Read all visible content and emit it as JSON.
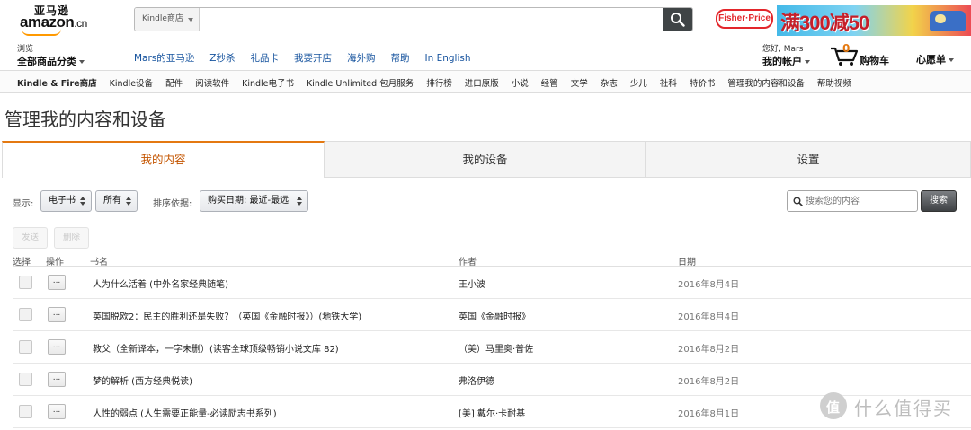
{
  "header": {
    "logo_cn": "亚马逊",
    "logo_en": "amazon",
    "logo_domain": ".cn",
    "search_category": "Kindle商店",
    "search_value": "",
    "ad_brand": "Fisher·Price",
    "ad_sale": "满300减50"
  },
  "nav": {
    "browse_small": "浏览",
    "browse_big": "全部商品分类",
    "links": [
      "Mars的亚马逊",
      "Z秒杀",
      "礼品卡",
      "我要开店",
      "海外购",
      "帮助",
      "In English"
    ],
    "greeting": "您好, Mars",
    "account": "我的帐户",
    "cart_count": "0",
    "cart_label": "购物车",
    "wishlist": "心愿单"
  },
  "subnav": [
    "Kindle & Fire商店",
    "Kindle设备",
    "配件",
    "阅读软件",
    "Kindle电子书",
    "Kindle Unlimited 包月服务",
    "排行榜",
    "进口原版",
    "小说",
    "经管",
    "文学",
    "杂志",
    "少儿",
    "社科",
    "特价书",
    "管理我的内容和设备",
    "帮助视频"
  ],
  "page_title": "管理我的内容和设备",
  "tabs": [
    {
      "label": "我的内容",
      "active": true
    },
    {
      "label": "我的设备",
      "active": false
    },
    {
      "label": "设置",
      "active": false
    }
  ],
  "filters": {
    "show_label": "显示:",
    "type_value": "电子书",
    "scope_value": "所有",
    "sort_label": "排序依据:",
    "sort_value": "购买日期: 最近-最远",
    "search_placeholder": "搜索您的内容",
    "search_button": "搜索"
  },
  "actions": {
    "send": "发送",
    "delete": "删除"
  },
  "table": {
    "headers": {
      "select": "选择",
      "action": "操作",
      "title": "书名",
      "author": "作者",
      "date": "日期"
    },
    "action_label": "...",
    "rows": [
      {
        "title": "人为什么活着 (中外名家经典随笔)",
        "author": "王小波",
        "date": "2016年8月4日"
      },
      {
        "title": "英国脱欧2：民主的胜利还是失败？（英国《金融时报》）(地铁大学)",
        "author": "英国《金融时报》",
        "date": "2016年8月4日"
      },
      {
        "title": "教父（全新译本，一字未删）(读客全球顶级畅销小说文库 82)",
        "author": "（美）马里奥·普佐",
        "date": "2016年8月2日"
      },
      {
        "title": "梦的解析 (西方经典悦读)",
        "author": "弗洛伊德",
        "date": "2016年8月2日"
      },
      {
        "title": "人性的弱点 (人生需要正能量-必读励志书系列)",
        "author": "[美] 戴尔·卡耐基",
        "date": "2016年8月1日"
      }
    ]
  },
  "watermark": "什么值得买",
  "colors": {
    "accent": "#e47911",
    "link": "#16539e",
    "search_button": "#3f4446"
  }
}
